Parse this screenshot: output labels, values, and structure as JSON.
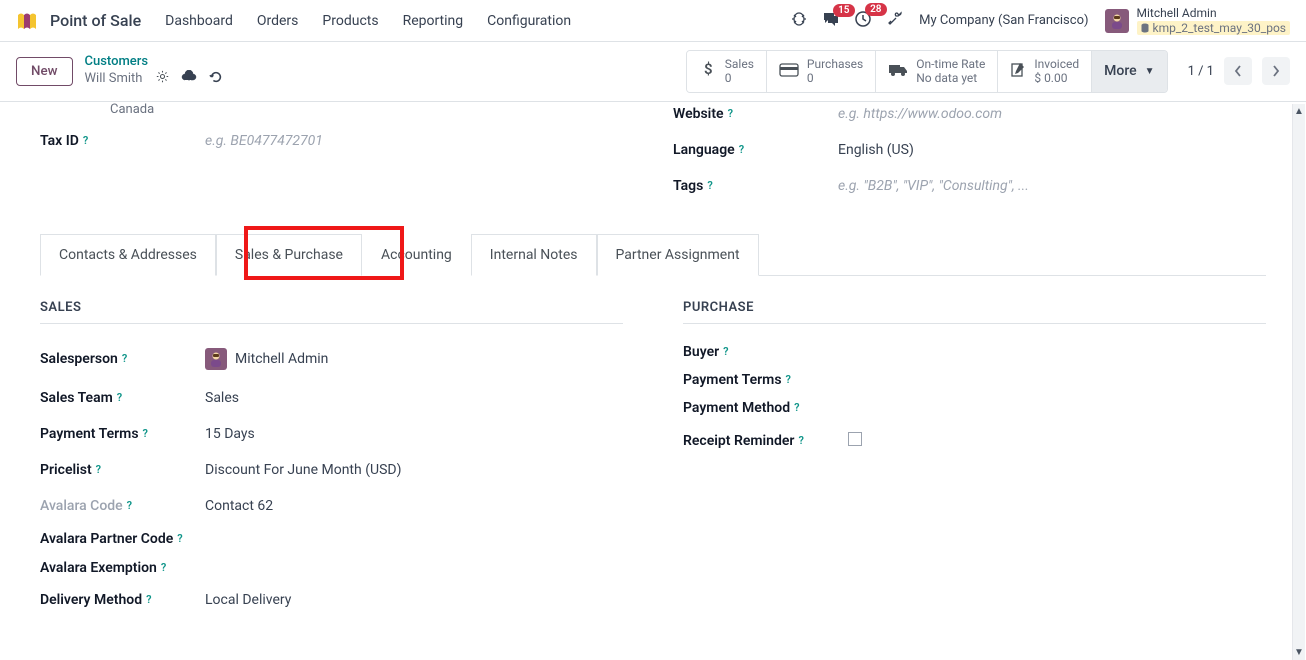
{
  "topbar": {
    "app_title": "Point of Sale",
    "menu": [
      "Dashboard",
      "Orders",
      "Products",
      "Reporting",
      "Configuration"
    ],
    "messages_badge": "15",
    "activities_badge": "28",
    "company": "My Company (San Francisco)",
    "user_name": "Mitchell Admin",
    "db_name": "kmp_2_test_may_30_pos"
  },
  "controlbar": {
    "new_label": "New",
    "breadcrumb_parent": "Customers",
    "breadcrumb_current": "Will Smith",
    "stats": {
      "sales_label": "Sales",
      "sales_value": "0",
      "purchases_label": "Purchases",
      "purchases_value": "0",
      "ontime_label": "On-time Rate",
      "ontime_value": "No data yet",
      "invoiced_label": "Invoiced",
      "invoiced_value": "$ 0.00",
      "more_label": "More"
    },
    "pager": "1 / 1"
  },
  "top_fields": {
    "country_value": "Canada",
    "taxid_label": "Tax ID",
    "taxid_placeholder": "e.g. BE0477472701",
    "website_label": "Website",
    "website_placeholder": "e.g. https://www.odoo.com",
    "language_label": "Language",
    "language_value": "English (US)",
    "tags_label": "Tags",
    "tags_placeholder": "e.g. \"B2B\", \"VIP\", \"Consulting\", ..."
  },
  "tabs": [
    "Contacts & Addresses",
    "Sales & Purchase",
    "Accounting",
    "Internal Notes",
    "Partner Assignment"
  ],
  "sales_section": {
    "title": "SALES",
    "salesperson_label": "Salesperson",
    "salesperson_value": "Mitchell Admin",
    "salesteam_label": "Sales Team",
    "salesteam_value": "Sales",
    "payment_terms_label": "Payment Terms",
    "payment_terms_value": "15 Days",
    "pricelist_label": "Pricelist",
    "pricelist_value": "Discount For June Month (USD)",
    "avalara_code_label": "Avalara Code",
    "avalara_code_value": "Contact 62",
    "avalara_partner_label": "Avalara Partner Code",
    "avalara_exemption_label": "Avalara Exemption",
    "delivery_method_label": "Delivery Method",
    "delivery_method_value": "Local Delivery"
  },
  "purchase_section": {
    "title": "PURCHASE",
    "buyer_label": "Buyer",
    "payment_terms_label": "Payment Terms",
    "payment_method_label": "Payment Method",
    "receipt_reminder_label": "Receipt Reminder"
  }
}
